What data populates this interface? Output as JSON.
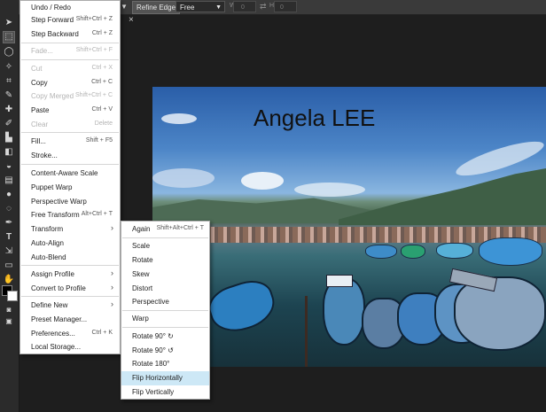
{
  "options_bar": {
    "refine_edge_label": "Refine Edge",
    "style_select": "Free",
    "width_label": "W:",
    "width_value": "0",
    "height_label": "H:",
    "height_value": "0",
    "close_tab": "×"
  },
  "toolbar": {
    "tools": [
      {
        "name": "move-tool-icon",
        "glyph": "➤"
      },
      {
        "name": "rect-select-tool-icon",
        "glyph": "⬚"
      },
      {
        "name": "lasso-tool-icon",
        "glyph": "◯"
      },
      {
        "name": "magic-wand-tool-icon",
        "glyph": "✧"
      },
      {
        "name": "crop-tool-icon",
        "glyph": "⌗"
      },
      {
        "name": "eyedropper-tool-icon",
        "glyph": "✎"
      },
      {
        "name": "healing-tool-icon",
        "glyph": "✚"
      },
      {
        "name": "brush-tool-icon",
        "glyph": "✐"
      },
      {
        "name": "stamp-tool-icon",
        "glyph": "▙"
      },
      {
        "name": "eraser-tool-icon",
        "glyph": "◧"
      },
      {
        "name": "bucket-tool-icon",
        "glyph": "◒"
      },
      {
        "name": "gradient-tool-icon",
        "glyph": "▤"
      },
      {
        "name": "blur-tool-icon",
        "glyph": "●"
      },
      {
        "name": "sponge-tool-icon",
        "glyph": "◌"
      },
      {
        "name": "pen-tool-icon",
        "glyph": "✒"
      },
      {
        "name": "text-tool-icon",
        "glyph": "T"
      },
      {
        "name": "path-select-tool-icon",
        "glyph": "⇲"
      },
      {
        "name": "shape-tool-icon",
        "glyph": "▭"
      },
      {
        "name": "hand-tool-icon",
        "glyph": "✋"
      },
      {
        "name": "zoom-tool-icon",
        "glyph": "⚲"
      }
    ]
  },
  "canvas": {
    "title_text": "Angela LEE"
  },
  "edit_menu": {
    "items": [
      {
        "label": "Undo / Redo",
        "shortcut": "",
        "disabled": false,
        "submenu": false
      },
      {
        "label": "Step Forward",
        "shortcut": "Shift+Ctrl + Z",
        "disabled": false,
        "submenu": false
      },
      {
        "label": "Step Backward",
        "shortcut": "Ctrl + Z",
        "disabled": false,
        "submenu": false
      },
      {
        "label": "Fade...",
        "shortcut": "Shift+Ctrl + F",
        "disabled": true,
        "submenu": false
      },
      {
        "label": "Cut",
        "shortcut": "Ctrl + X",
        "disabled": true,
        "submenu": false
      },
      {
        "label": "Copy",
        "shortcut": "Ctrl + C",
        "disabled": false,
        "submenu": false
      },
      {
        "label": "Copy Merged",
        "shortcut": "Shift+Ctrl + C",
        "disabled": true,
        "submenu": false
      },
      {
        "label": "Paste",
        "shortcut": "Ctrl + V",
        "disabled": false,
        "submenu": false
      },
      {
        "label": "Clear",
        "shortcut": "Delete",
        "disabled": true,
        "submenu": false
      },
      {
        "label": "Fill...",
        "shortcut": "Shift + F5",
        "disabled": false,
        "submenu": false
      },
      {
        "label": "Stroke...",
        "shortcut": "",
        "disabled": false,
        "submenu": false
      },
      {
        "label": "Content-Aware Scale",
        "shortcut": "",
        "disabled": false,
        "submenu": false
      },
      {
        "label": "Puppet Warp",
        "shortcut": "",
        "disabled": false,
        "submenu": false
      },
      {
        "label": "Perspective Warp",
        "shortcut": "",
        "disabled": false,
        "submenu": false
      },
      {
        "label": "Free Transform",
        "shortcut": "Alt+Ctrl + T",
        "disabled": false,
        "submenu": false
      },
      {
        "label": "Transform",
        "shortcut": "",
        "disabled": false,
        "submenu": true
      },
      {
        "label": "Auto-Align",
        "shortcut": "",
        "disabled": false,
        "submenu": false
      },
      {
        "label": "Auto-Blend",
        "shortcut": "",
        "disabled": false,
        "submenu": false
      },
      {
        "label": "Assign Profile",
        "shortcut": "",
        "disabled": false,
        "submenu": true
      },
      {
        "label": "Convert to Profile",
        "shortcut": "",
        "disabled": false,
        "submenu": true
      },
      {
        "label": "Define New",
        "shortcut": "",
        "disabled": false,
        "submenu": true
      },
      {
        "label": "Preset Manager...",
        "shortcut": "",
        "disabled": false,
        "submenu": false
      },
      {
        "label": "Preferences...",
        "shortcut": "Ctrl + K",
        "disabled": false,
        "submenu": false
      },
      {
        "label": "Local Storage...",
        "shortcut": "",
        "disabled": false,
        "submenu": false
      }
    ]
  },
  "transform_menu": {
    "items": [
      {
        "label": "Again",
        "shortcut": "Shift+Alt+Ctrl + T"
      },
      {
        "label": "Scale",
        "shortcut": ""
      },
      {
        "label": "Rotate",
        "shortcut": ""
      },
      {
        "label": "Skew",
        "shortcut": ""
      },
      {
        "label": "Distort",
        "shortcut": ""
      },
      {
        "label": "Perspective",
        "shortcut": ""
      },
      {
        "label": "Warp",
        "shortcut": ""
      },
      {
        "label": "Rotate 90° ↻",
        "shortcut": ""
      },
      {
        "label": "Rotate 90° ↺",
        "shortcut": ""
      },
      {
        "label": "Rotate 180°",
        "shortcut": ""
      },
      {
        "label": "Flip Horizontally",
        "shortcut": "",
        "highlighted": true
      },
      {
        "label": "Flip Vertically",
        "shortcut": ""
      }
    ]
  }
}
